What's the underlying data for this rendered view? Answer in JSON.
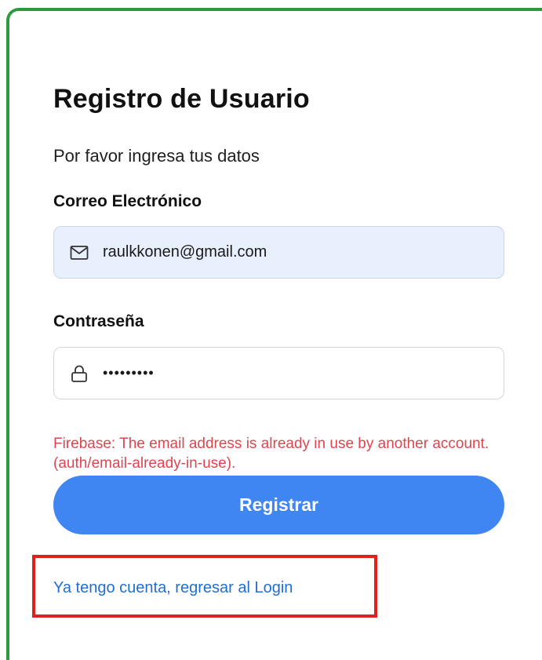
{
  "colors": {
    "frame": "#2e9a3e",
    "primary": "#3f86f2",
    "error": "#e04450",
    "link": "#1f6fd1",
    "highlight": "#e0201c",
    "email_field_bg": "#e8f0fe"
  },
  "form": {
    "title": "Registro de Usuario",
    "subtitle": "Por favor ingresa tus datos",
    "email": {
      "label": "Correo Electrónico",
      "value": "raulkkonen@gmail.com",
      "icon": "envelope-icon"
    },
    "password": {
      "label": "Contraseña",
      "value": "•••••••••",
      "icon": "lock-icon"
    },
    "error_message": "Firebase: The email address is already in use by another account. (auth/email-already-in-use).",
    "submit_label": "Registrar",
    "login_link": "Ya tengo cuenta, regresar al Login"
  }
}
